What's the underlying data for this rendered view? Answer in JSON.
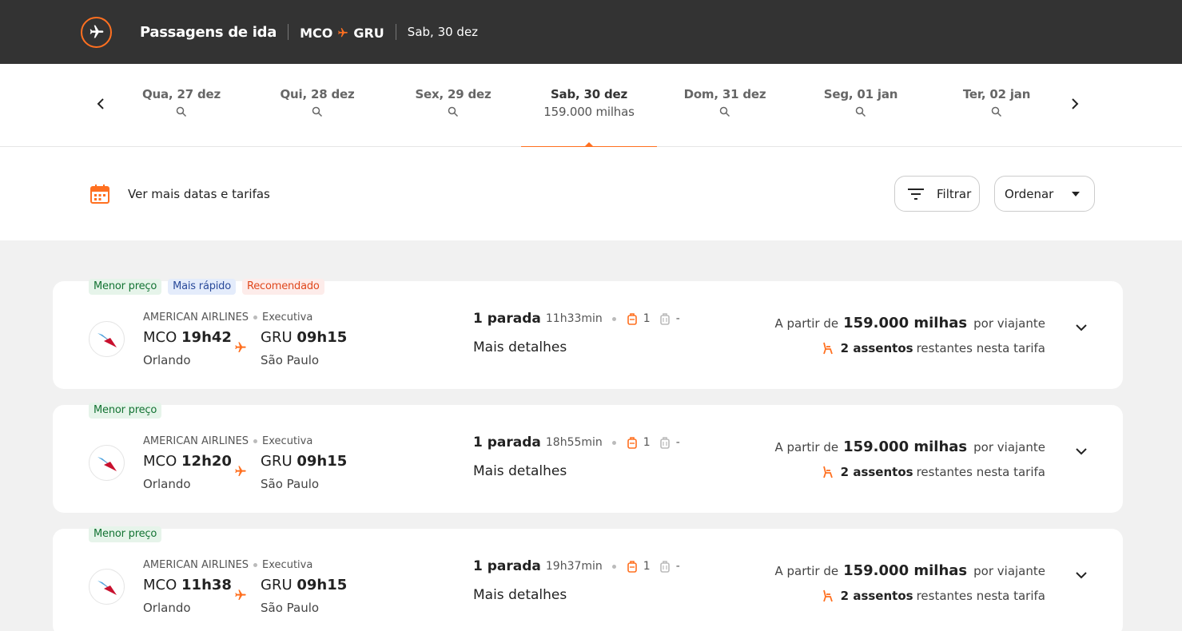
{
  "header": {
    "title": "Passagens de ida",
    "origin": "MCO",
    "destination": "GRU",
    "date": "Sab, 30 dez"
  },
  "date_tabs": [
    {
      "label": "Qua, 27 dez",
      "miles": ""
    },
    {
      "label": "Qui, 28 dez",
      "miles": ""
    },
    {
      "label": "Sex, 29 dez",
      "miles": ""
    },
    {
      "label": "Sab, 30 dez",
      "miles": "159.000 milhas",
      "active": true
    },
    {
      "label": "Dom, 31 dez",
      "miles": ""
    },
    {
      "label": "Seg, 01 jan",
      "miles": ""
    },
    {
      "label": "Ter, 02 jan",
      "miles": ""
    }
  ],
  "toolbar": {
    "more_dates": "Ver mais datas e tarifas",
    "filter_label": "Filtrar",
    "order_label": "Ordenar"
  },
  "colors": {
    "accent": "#ff7020",
    "header_bg": "#333333"
  },
  "flights": [
    {
      "badges": [
        "Menor preço",
        "Mais rápido",
        "Recomendado"
      ],
      "airline": "AMERICAN AIRLINES",
      "cabin": "Executiva",
      "dep_code": "MCO",
      "dep_time": "19h42",
      "dep_city": "Orlando",
      "arr_code": "GRU",
      "arr_time": "09h15",
      "arr_city": "São Paulo",
      "stops": "1 parada",
      "duration": "11h33min",
      "carry_on": "1",
      "checked": "-",
      "details": "Mais detalhes",
      "price_prefix": "A partir de",
      "miles": "159.000 milhas",
      "price_suffix": "por viajante",
      "seats": "2 assentos",
      "seats_suffix": "restantes nesta tarifa"
    },
    {
      "badges": [
        "Menor preço"
      ],
      "airline": "AMERICAN AIRLINES",
      "cabin": "Executiva",
      "dep_code": "MCO",
      "dep_time": "12h20",
      "dep_city": "Orlando",
      "arr_code": "GRU",
      "arr_time": "09h15",
      "arr_city": "São Paulo",
      "stops": "1 parada",
      "duration": "18h55min",
      "carry_on": "1",
      "checked": "-",
      "details": "Mais detalhes",
      "price_prefix": "A partir de",
      "miles": "159.000 milhas",
      "price_suffix": "por viajante",
      "seats": "2 assentos",
      "seats_suffix": "restantes nesta tarifa"
    },
    {
      "badges": [
        "Menor preço"
      ],
      "airline": "AMERICAN AIRLINES",
      "cabin": "Executiva",
      "dep_code": "MCO",
      "dep_time": "11h38",
      "dep_city": "Orlando",
      "arr_code": "GRU",
      "arr_time": "09h15",
      "arr_city": "São Paulo",
      "stops": "1 parada",
      "duration": "19h37min",
      "carry_on": "1",
      "checked": "-",
      "details": "Mais detalhes",
      "price_prefix": "A partir de",
      "miles": "159.000 milhas",
      "price_suffix": "por viajante",
      "seats": "2 assentos",
      "seats_suffix": "restantes nesta tarifa"
    }
  ]
}
